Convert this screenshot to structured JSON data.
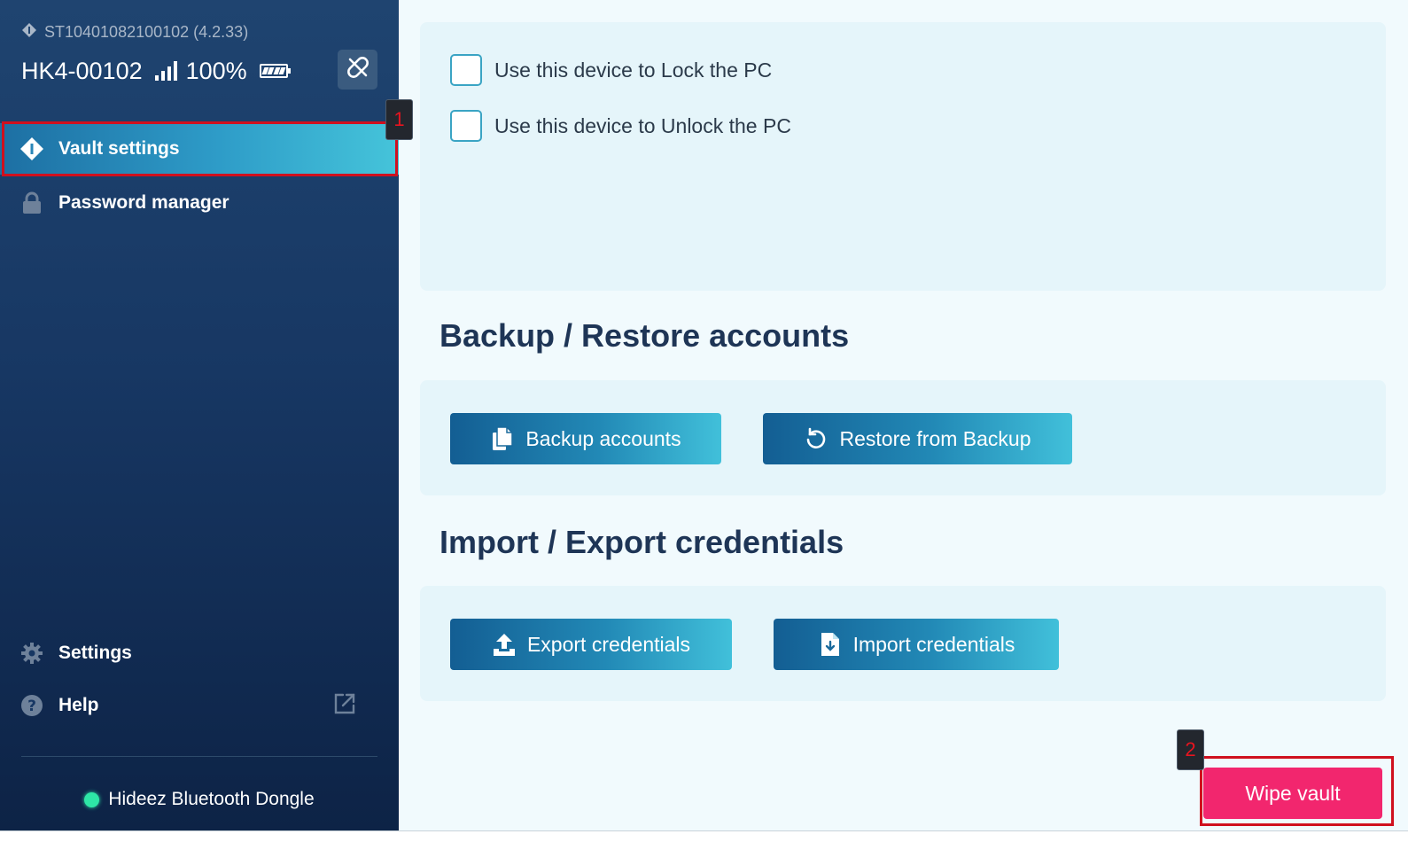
{
  "device": {
    "serial": "ST10401082100102 (4.2.33)",
    "name": "HK4-00102",
    "battery": "100%"
  },
  "sidebar": {
    "items": [
      {
        "label": "Vault settings",
        "icon": "vault-icon",
        "active": true
      },
      {
        "label": "Password manager",
        "icon": "lock-icon",
        "active": false
      }
    ],
    "bottom_items": [
      {
        "label": "Settings",
        "icon": "gear-icon"
      },
      {
        "label": "Help",
        "icon": "question-icon"
      }
    ],
    "dongle_label": "Hideez Bluetooth Dongle",
    "dongle_status_color": "#2ee6a6"
  },
  "main": {
    "options": [
      {
        "label": "Use this device to Lock the PC",
        "checked": false
      },
      {
        "label": "Use this device to Unlock the PC",
        "checked": false
      }
    ],
    "backup_section": {
      "title": "Backup / Restore accounts",
      "backup_label": "Backup accounts",
      "restore_label": "Restore from Backup"
    },
    "import_section": {
      "title": "Import / Export credentials",
      "export_label": "Export credentials",
      "import_label": "Import credentials"
    },
    "wipe_label": "Wipe vault"
  },
  "annotations": {
    "marker_1": "1",
    "marker_2": "2"
  },
  "colors": {
    "accent": "#2e9cc8",
    "danger": "#f2266e",
    "highlight": "#d0101e"
  }
}
